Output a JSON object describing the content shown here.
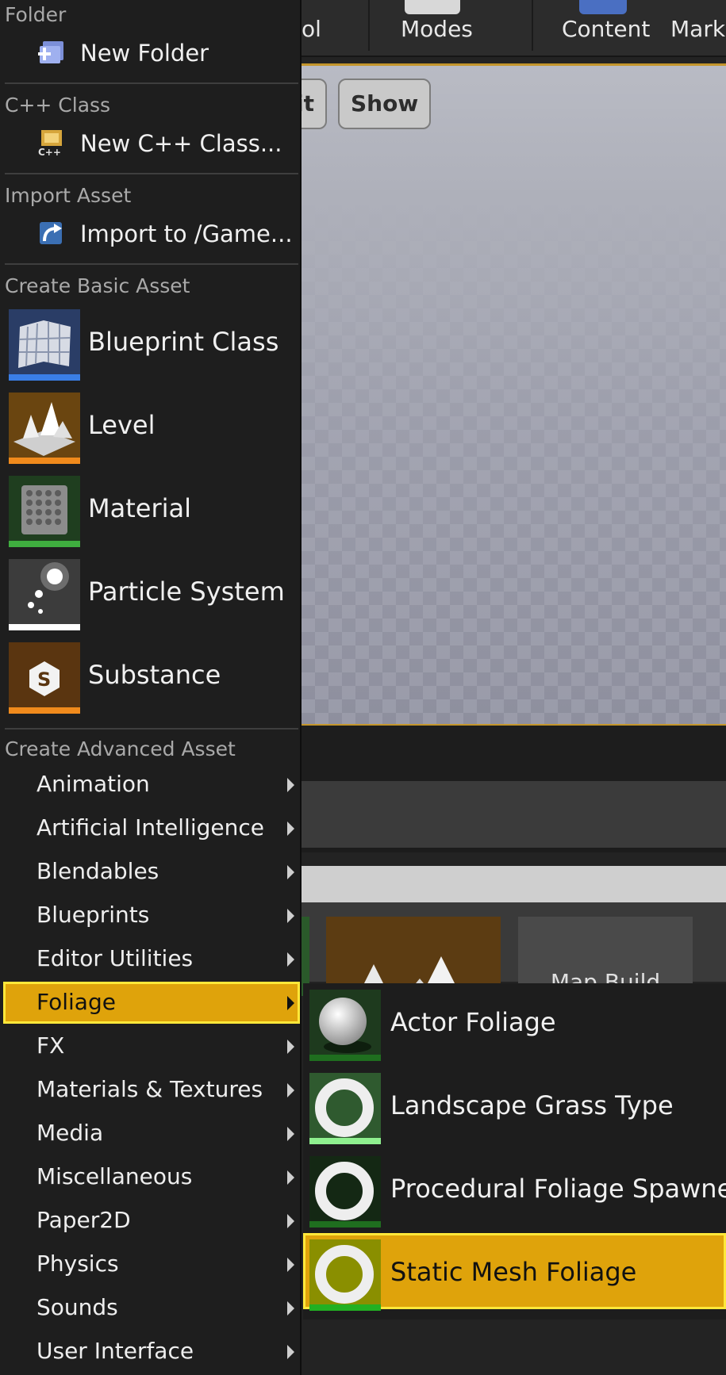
{
  "toolbar": {
    "items": [
      {
        "label": "ol"
      },
      {
        "label": "Modes"
      },
      {
        "label": "Content"
      },
      {
        "label": "Mark"
      }
    ]
  },
  "viewport": {
    "buttons": [
      {
        "label": "it"
      },
      {
        "label": "Show"
      }
    ]
  },
  "content_browser": {
    "tile_label": "Map Build"
  },
  "menu": {
    "folder_section": {
      "header": "Folder",
      "item": {
        "label": "New Folder",
        "icon": "new-folder-icon"
      }
    },
    "cpp_section": {
      "header": "C++ Class",
      "item": {
        "label": "New C++ Class...",
        "icon": "cpp-class-icon"
      }
    },
    "import_section": {
      "header": "Import Asset",
      "item": {
        "label": "Import to /Game...",
        "icon": "import-icon"
      }
    },
    "basic_section": {
      "header": "Create Basic Asset",
      "items": [
        {
          "label": "Blueprint Class",
          "icon": "blueprint-class-icon",
          "bar_color": "#3a7ee6"
        },
        {
          "label": "Level",
          "icon": "level-icon",
          "bar_color": "#f08a1c"
        },
        {
          "label": "Material",
          "icon": "material-icon",
          "bar_color": "#3fae3f"
        },
        {
          "label": "Particle System",
          "icon": "particle-system-icon",
          "bar_color": "#ffffff"
        },
        {
          "label": "Substance",
          "icon": "substance-icon",
          "bar_color": "#f08a1c"
        }
      ]
    },
    "advanced_section": {
      "header": "Create Advanced Asset",
      "items": [
        {
          "label": "Animation"
        },
        {
          "label": "Artificial Intelligence"
        },
        {
          "label": "Blendables"
        },
        {
          "label": "Blueprints"
        },
        {
          "label": "Editor Utilities"
        },
        {
          "label": "Foliage",
          "selected": true
        },
        {
          "label": "FX"
        },
        {
          "label": "Materials & Textures"
        },
        {
          "label": "Media"
        },
        {
          "label": "Miscellaneous"
        },
        {
          "label": "Paper2D"
        },
        {
          "label": "Physics"
        },
        {
          "label": "Sounds"
        },
        {
          "label": "User Interface"
        }
      ]
    }
  },
  "foliage_submenu": {
    "items": [
      {
        "label": "Actor Foliage",
        "icon": "sphere-icon",
        "bar_color": "#1f6e1f"
      },
      {
        "label": "Landscape Grass Type",
        "icon": "torus-icon",
        "bar_color": "#8ff08f"
      },
      {
        "label": "Procedural Foliage Spawner",
        "icon": "torus-icon",
        "bar_color": "#1f6e1f"
      },
      {
        "label": "Static Mesh Foliage",
        "icon": "torus-icon",
        "bar_color": "#22b022",
        "selected": true
      }
    ]
  },
  "colors": {
    "selection": "#dfa30b",
    "selection_outline": "#ffe83a",
    "menu_bg": "#1e1e1e"
  }
}
